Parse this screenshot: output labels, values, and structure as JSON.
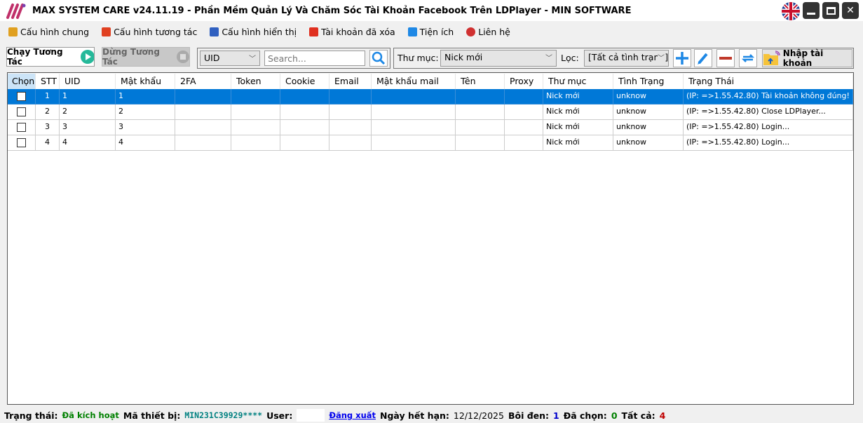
{
  "window": {
    "title": "MAX SYSTEM CARE v24.11.19 - Phần Mềm Quản Lý Và Chăm Sóc Tài Khoản Facebook Trên LDPlayer - MIN SOFTWARE"
  },
  "menu": [
    {
      "label": "Cấu hình chung",
      "icon": "wrench-icon",
      "color": "#e0a020"
    },
    {
      "label": "Cấu hình tương tác",
      "icon": "interaction-config-icon",
      "color": "#e04020"
    },
    {
      "label": "Cấu hình hiển thị",
      "icon": "display-config-icon",
      "color": "#3060c0"
    },
    {
      "label": "Tài khoản đã xóa",
      "icon": "trash-icon",
      "color": "#e03020"
    },
    {
      "label": "Tiện ích",
      "icon": "grid-icon",
      "color": "#1e88e5"
    },
    {
      "label": "Liên hệ",
      "icon": "lifebuoy-icon",
      "color": "#d03030"
    }
  ],
  "toolbar": {
    "run_label": "Chạy Tương Tác",
    "stop_label": "Dừng Tương Tác",
    "search_field": "UID",
    "search_placeholder": "Search...",
    "folder_label": "Thư mục:",
    "folder_value": "Nick mới",
    "filter_label": "Lọc:",
    "filter_value": "[Tất cả tình trạng]",
    "import_label": "Nhập tài khoản"
  },
  "table": {
    "columns": [
      "Chọn",
      "STT",
      "UID",
      "Mật khẩu",
      "2FA",
      "Token",
      "Cookie",
      "Email",
      "Mật khẩu mail",
      "Tên",
      "Proxy",
      "Thư mục",
      "Tình Trạng",
      "Trạng Thái"
    ],
    "rows": [
      {
        "checked": false,
        "selected": true,
        "cells": [
          "",
          "1",
          "1",
          "1",
          "",
          "",
          "",
          "",
          "",
          "",
          "",
          "Nick mới",
          "unknow",
          "(IP: =>1.55.42.80) Tài khoản không đúng!"
        ]
      },
      {
        "checked": false,
        "selected": false,
        "cells": [
          "",
          "2",
          "2",
          "2",
          "",
          "",
          "",
          "",
          "",
          "",
          "",
          "Nick mới",
          "unknow",
          "(IP: =>1.55.42.80) Close LDPlayer..."
        ]
      },
      {
        "checked": false,
        "selected": false,
        "cells": [
          "",
          "3",
          "3",
          "3",
          "",
          "",
          "",
          "",
          "",
          "",
          "",
          "Nick mới",
          "unknow",
          "(IP: =>1.55.42.80) Login..."
        ]
      },
      {
        "checked": false,
        "selected": false,
        "cells": [
          "",
          "4",
          "4",
          "4",
          "",
          "",
          "",
          "",
          "",
          "",
          "",
          "Nick mới",
          "unknow",
          "(IP: =>1.55.42.80) Login..."
        ]
      }
    ]
  },
  "status": {
    "state_label": "Trạng thái:",
    "state_value": "Đã kích hoạt",
    "device_label": "Mã thiết bị:",
    "device_value": "MIN231C39929****",
    "user_label": "User:",
    "user_value": "",
    "logout": "Đăng xuất",
    "expiry_label": "Ngày hết hạn:",
    "expiry_value": "12/12/2025",
    "highlight_label": "Bôi đen:",
    "highlight_value": "1",
    "chosen_label": "Đã chọn:",
    "chosen_value": "0",
    "total_label": "Tất cả:",
    "total_value": "4"
  },
  "colors": {
    "selection": "#0078d7",
    "active": "#008000",
    "device": "#008080",
    "accent": "#1e88e5"
  }
}
